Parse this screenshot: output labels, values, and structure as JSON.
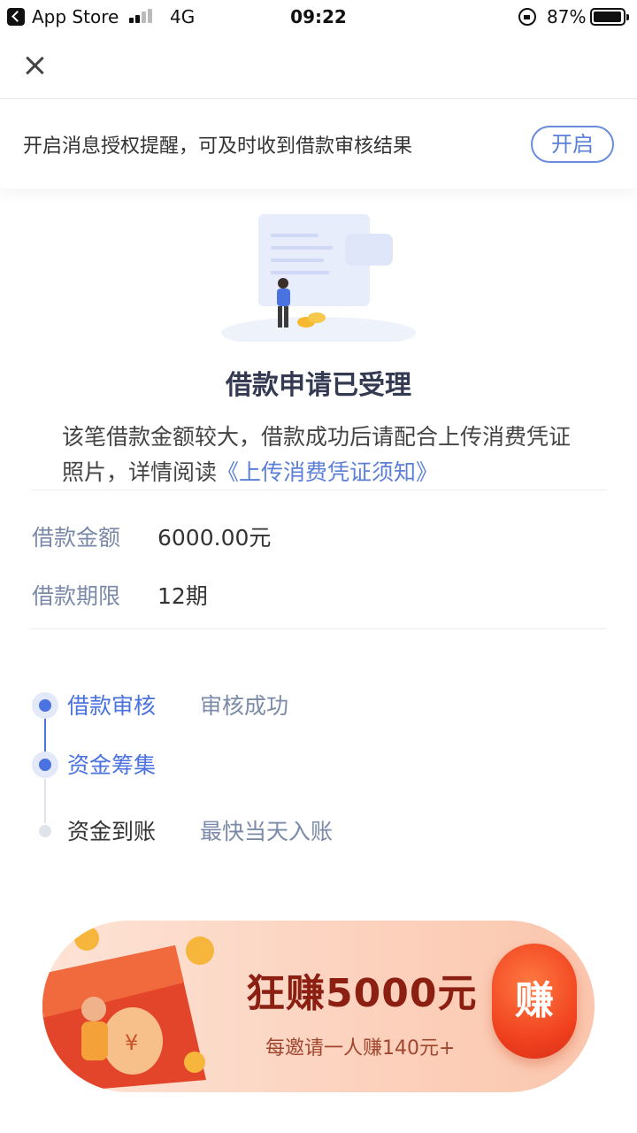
{
  "status_bar": {
    "back_app": "App Store",
    "network": "4G",
    "time": "09:22",
    "battery": "87%"
  },
  "nav": {
    "close_icon": "close-icon"
  },
  "notice": {
    "text": "开启消息授权提醒，可及时收到借款审核结果",
    "button": "开启"
  },
  "result": {
    "title": "借款申请已受理",
    "desc_prefix": "该笔借款金额较大，借款成功后请配合上传消费凭证照片，详情阅读",
    "desc_link": "《上传消费凭证须知》"
  },
  "loan_info": {
    "amount_label": "借款金额",
    "amount_value": "6000.00元",
    "term_label": "借款期限",
    "term_value": "12期"
  },
  "progress": [
    {
      "label": "借款审核",
      "status": "审核成功",
      "state": "done"
    },
    {
      "label": "资金筹集",
      "status": "",
      "state": "done"
    },
    {
      "label": "资金到账",
      "status": "最快当天入账",
      "state": "pending"
    }
  ],
  "banner": {
    "title": "狂赚5000元",
    "subtitle": "每邀请一人赚140元+",
    "button": "赚"
  },
  "colors": {
    "accent": "#4a72e0",
    "label_gray": "#7a8aa8",
    "banner_red": "#f0401e"
  }
}
